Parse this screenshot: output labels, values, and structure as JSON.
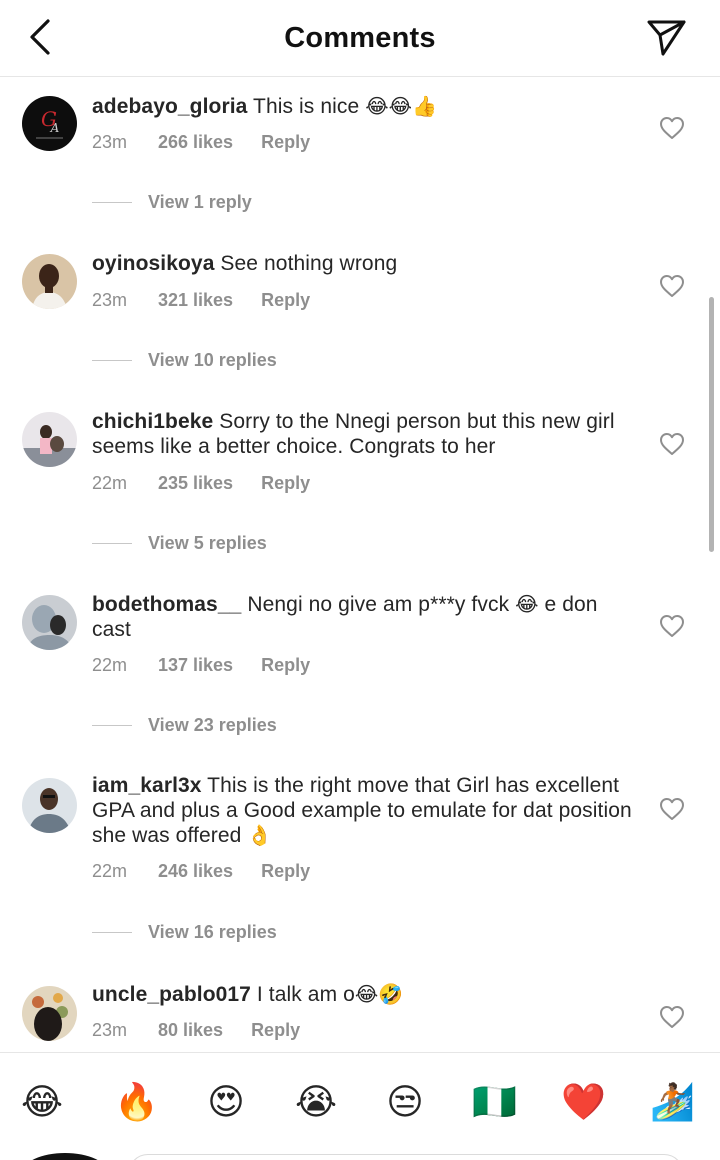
{
  "header": {
    "title": "Comments"
  },
  "comments": [
    {
      "username": "adebayo_gloria",
      "text": "This is nice",
      "emoji": "😂😂👍",
      "time": "23m",
      "likes": "266 likes",
      "reply": "Reply",
      "view_replies": "View 1 reply"
    },
    {
      "username": "oyinosikoya",
      "text": "See nothing wrong",
      "time": "23m",
      "likes": "321 likes",
      "reply": "Reply",
      "view_replies": "View 10 replies"
    },
    {
      "username": "chichi1beke",
      "text": "Sorry to the Nnegi person but this new girl seems like a better choice. Congrats to her",
      "time": "22m",
      "likes": "235 likes",
      "reply": "Reply",
      "view_replies": "View 5 replies"
    },
    {
      "username": "bodethomas__",
      "text_a": "Nengi no give am p***y fvck",
      "emoji": "😂",
      "text_b": "e don cast",
      "time": "22m",
      "likes": "137 likes",
      "reply": "Reply",
      "view_replies": "View 23 replies"
    },
    {
      "username": "iam_karl3x",
      "text": "This is the right move that Girl has excellent GPA and plus a Good example to emulate for dat position she was offered",
      "emoji": "👌",
      "time": "22m",
      "likes": "246 likes",
      "reply": "Reply",
      "view_replies": "View 16 replies"
    },
    {
      "username": "uncle_pablo017",
      "text": "I talk am o",
      "emoji": "😂🤣",
      "time": "23m",
      "likes": "80 likes",
      "reply": "Reply"
    }
  ],
  "emoji_bar": [
    "😂",
    "🔥",
    "😍",
    "😭",
    "😒",
    "🇳🇬",
    "❤️",
    "🏄🏾"
  ],
  "colors": {
    "text": "#262626",
    "secondary": "#8e8e8e",
    "divider": "#e6e6e6"
  },
  "icons": [
    "chevron-left-icon",
    "send-icon",
    "heart-outline-icon"
  ]
}
